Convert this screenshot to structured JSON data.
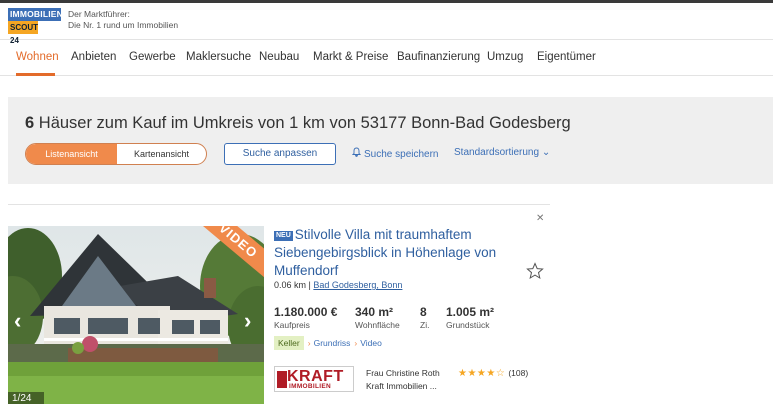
{
  "header": {
    "logo_line1": "IMMOBILIEN",
    "logo_line2": "SCOUT 24",
    "tagline_line1": "Der Marktführer:",
    "tagline_line2": "Die Nr. 1 rund um Immobilien"
  },
  "nav": {
    "items": [
      "Wohnen",
      "Anbieten",
      "Gewerbe",
      "Maklersuche",
      "Neubau",
      "Markt & Preise",
      "Baufinanzierung",
      "Umzug",
      "Eigentümer"
    ],
    "active": "Wohnen"
  },
  "search": {
    "count": "6",
    "title_rest": "Häuser zum Kauf im Umkreis von 1 km von 53177 Bonn-Bad Godesberg",
    "view_list": "Listenansicht",
    "view_map": "Kartenansicht",
    "adjust_button": "Suche anpassen",
    "save_search": "Suche speichern",
    "sort": "Standardsortierung ⌄"
  },
  "listing": {
    "badge": "NEU",
    "title": "Stilvolle Villa mit traumhaftem Siebengebirgsblick in Höhenlage von Muffendorf",
    "distance": "0.06 km",
    "location": "Bad Godesberg, Bonn",
    "video_ribbon": "VIDEO",
    "photo_counter": "1/24",
    "price": "1.180.000 €",
    "price_label": "Kaufpreis",
    "living_area": "340 m²",
    "living_area_label": "Wohnfläche",
    "rooms": "8",
    "rooms_label": "Zi.",
    "plot": "1.005 m²",
    "plot_label": "Grundstück",
    "features": {
      "keller": "Keller",
      "grundriss": "Grundriss",
      "video": "Video"
    },
    "agency": {
      "logo_word": "KRAFT",
      "logo_sub": "IMMOBILIEN",
      "contact_name": "Frau Christine Roth",
      "company": "Kraft Immobilien ...",
      "stars": "★★★★☆",
      "rating_count": "(108)"
    }
  },
  "colors": {
    "accent": "#e36b2a",
    "link": "#3c6fb6",
    "brand_blue": "#3c6fb6",
    "brand_yellow": "#f5a623"
  },
  "icons": {
    "bell": "bell-icon",
    "star": "star-icon",
    "close": "close-icon",
    "arrows": "chevron-icons"
  }
}
